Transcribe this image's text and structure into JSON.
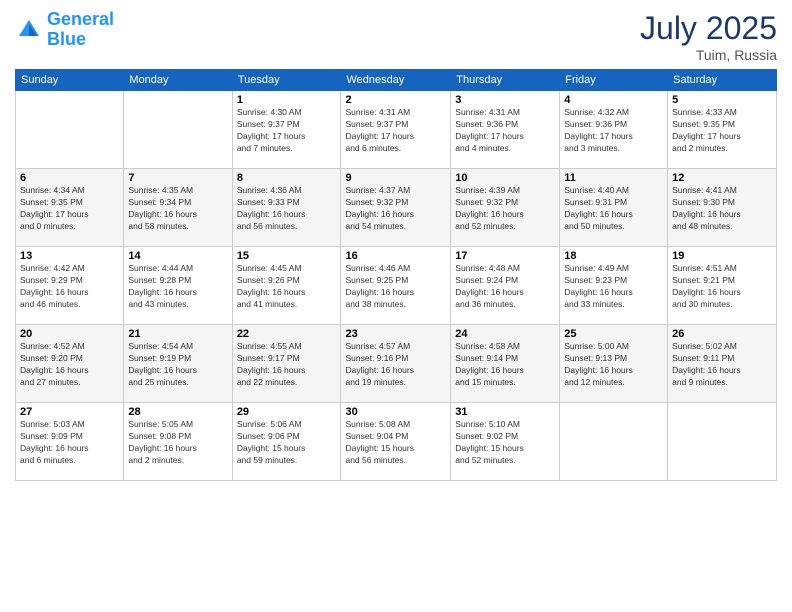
{
  "header": {
    "logo_line1": "General",
    "logo_line2": "Blue",
    "month_year": "July 2025",
    "location": "Tuim, Russia"
  },
  "weekdays": [
    "Sunday",
    "Monday",
    "Tuesday",
    "Wednesday",
    "Thursday",
    "Friday",
    "Saturday"
  ],
  "weeks": [
    [
      {
        "day": "",
        "detail": ""
      },
      {
        "day": "",
        "detail": ""
      },
      {
        "day": "1",
        "detail": "Sunrise: 4:30 AM\nSunset: 9:37 PM\nDaylight: 17 hours\nand 7 minutes."
      },
      {
        "day": "2",
        "detail": "Sunrise: 4:31 AM\nSunset: 9:37 PM\nDaylight: 17 hours\nand 6 minutes."
      },
      {
        "day": "3",
        "detail": "Sunrise: 4:31 AM\nSunset: 9:36 PM\nDaylight: 17 hours\nand 4 minutes."
      },
      {
        "day": "4",
        "detail": "Sunrise: 4:32 AM\nSunset: 9:36 PM\nDaylight: 17 hours\nand 3 minutes."
      },
      {
        "day": "5",
        "detail": "Sunrise: 4:33 AM\nSunset: 9:35 PM\nDaylight: 17 hours\nand 2 minutes."
      }
    ],
    [
      {
        "day": "6",
        "detail": "Sunrise: 4:34 AM\nSunset: 9:35 PM\nDaylight: 17 hours\nand 0 minutes."
      },
      {
        "day": "7",
        "detail": "Sunrise: 4:35 AM\nSunset: 9:34 PM\nDaylight: 16 hours\nand 58 minutes."
      },
      {
        "day": "8",
        "detail": "Sunrise: 4:36 AM\nSunset: 9:33 PM\nDaylight: 16 hours\nand 56 minutes."
      },
      {
        "day": "9",
        "detail": "Sunrise: 4:37 AM\nSunset: 9:32 PM\nDaylight: 16 hours\nand 54 minutes."
      },
      {
        "day": "10",
        "detail": "Sunrise: 4:39 AM\nSunset: 9:32 PM\nDaylight: 16 hours\nand 52 minutes."
      },
      {
        "day": "11",
        "detail": "Sunrise: 4:40 AM\nSunset: 9:31 PM\nDaylight: 16 hours\nand 50 minutes."
      },
      {
        "day": "12",
        "detail": "Sunrise: 4:41 AM\nSunset: 9:30 PM\nDaylight: 16 hours\nand 48 minutes."
      }
    ],
    [
      {
        "day": "13",
        "detail": "Sunrise: 4:42 AM\nSunset: 9:29 PM\nDaylight: 16 hours\nand 46 minutes."
      },
      {
        "day": "14",
        "detail": "Sunrise: 4:44 AM\nSunset: 9:28 PM\nDaylight: 16 hours\nand 43 minutes."
      },
      {
        "day": "15",
        "detail": "Sunrise: 4:45 AM\nSunset: 9:26 PM\nDaylight: 16 hours\nand 41 minutes."
      },
      {
        "day": "16",
        "detail": "Sunrise: 4:46 AM\nSunset: 9:25 PM\nDaylight: 16 hours\nand 38 minutes."
      },
      {
        "day": "17",
        "detail": "Sunrise: 4:48 AM\nSunset: 9:24 PM\nDaylight: 16 hours\nand 36 minutes."
      },
      {
        "day": "18",
        "detail": "Sunrise: 4:49 AM\nSunset: 9:23 PM\nDaylight: 16 hours\nand 33 minutes."
      },
      {
        "day": "19",
        "detail": "Sunrise: 4:51 AM\nSunset: 9:21 PM\nDaylight: 16 hours\nand 30 minutes."
      }
    ],
    [
      {
        "day": "20",
        "detail": "Sunrise: 4:52 AM\nSunset: 9:20 PM\nDaylight: 16 hours\nand 27 minutes."
      },
      {
        "day": "21",
        "detail": "Sunrise: 4:54 AM\nSunset: 9:19 PM\nDaylight: 16 hours\nand 25 minutes."
      },
      {
        "day": "22",
        "detail": "Sunrise: 4:55 AM\nSunset: 9:17 PM\nDaylight: 16 hours\nand 22 minutes."
      },
      {
        "day": "23",
        "detail": "Sunrise: 4:57 AM\nSunset: 9:16 PM\nDaylight: 16 hours\nand 19 minutes."
      },
      {
        "day": "24",
        "detail": "Sunrise: 4:58 AM\nSunset: 9:14 PM\nDaylight: 16 hours\nand 15 minutes."
      },
      {
        "day": "25",
        "detail": "Sunrise: 5:00 AM\nSunset: 9:13 PM\nDaylight: 16 hours\nand 12 minutes."
      },
      {
        "day": "26",
        "detail": "Sunrise: 5:02 AM\nSunset: 9:11 PM\nDaylight: 16 hours\nand 9 minutes."
      }
    ],
    [
      {
        "day": "27",
        "detail": "Sunrise: 5:03 AM\nSunset: 9:09 PM\nDaylight: 16 hours\nand 6 minutes."
      },
      {
        "day": "28",
        "detail": "Sunrise: 5:05 AM\nSunset: 9:08 PM\nDaylight: 16 hours\nand 2 minutes."
      },
      {
        "day": "29",
        "detail": "Sunrise: 5:06 AM\nSunset: 9:06 PM\nDaylight: 15 hours\nand 59 minutes."
      },
      {
        "day": "30",
        "detail": "Sunrise: 5:08 AM\nSunset: 9:04 PM\nDaylight: 15 hours\nand 56 minutes."
      },
      {
        "day": "31",
        "detail": "Sunrise: 5:10 AM\nSunset: 9:02 PM\nDaylight: 15 hours\nand 52 minutes."
      },
      {
        "day": "",
        "detail": ""
      },
      {
        "day": "",
        "detail": ""
      }
    ]
  ]
}
